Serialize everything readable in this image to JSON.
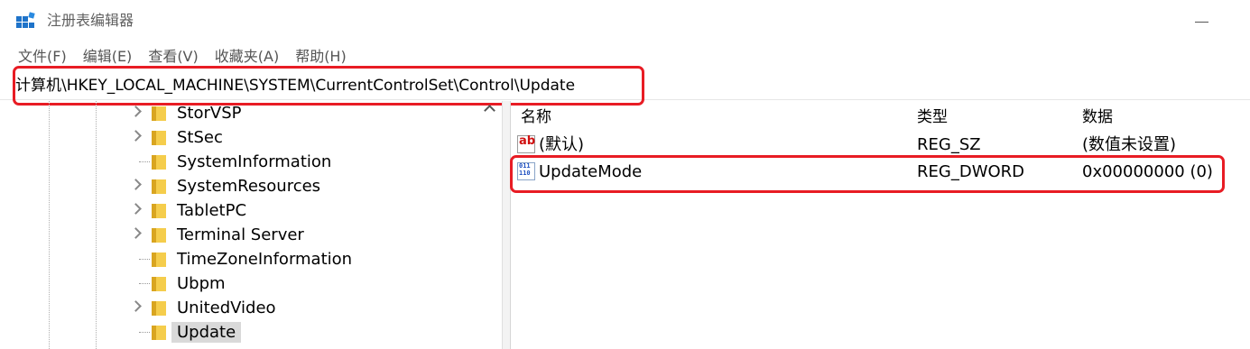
{
  "window": {
    "title": "注册表编辑器",
    "icon": "registry-editor-icon"
  },
  "menu": [
    "文件(F)",
    "编辑(E)",
    "查看(V)",
    "收藏夹(A)",
    "帮助(H)"
  ],
  "address": "计算机\\HKEY_LOCAL_MACHINE\\SYSTEM\\CurrentControlSet\\Control\\Update",
  "tree": [
    {
      "label": "StorVSP",
      "expandable": true
    },
    {
      "label": "StSec",
      "expandable": true
    },
    {
      "label": "SystemInformation",
      "expandable": false
    },
    {
      "label": "SystemResources",
      "expandable": true
    },
    {
      "label": "TabletPC",
      "expandable": true
    },
    {
      "label": "Terminal Server",
      "expandable": true
    },
    {
      "label": "TimeZoneInformation",
      "expandable": false
    },
    {
      "label": "Ubpm",
      "expandable": false
    },
    {
      "label": "UnitedVideo",
      "expandable": true
    },
    {
      "label": "Update",
      "expandable": false,
      "selected": true
    }
  ],
  "columns": {
    "name": "名称",
    "type": "类型",
    "data": "数据"
  },
  "values": [
    {
      "icon": "string-value-icon",
      "icon_glyph": "ab",
      "name": "(默认)",
      "type": "REG_SZ",
      "data": "(数值未设置)"
    },
    {
      "icon": "binary-value-icon",
      "icon_glyph": "011\n110",
      "name": "UpdateMode",
      "type": "REG_DWORD",
      "data": "0x00000000 (0)"
    }
  ],
  "colors": {
    "highlight": "#e81c24",
    "folder": "#f5cd4c",
    "selected_bg": "#d9d9d9"
  }
}
